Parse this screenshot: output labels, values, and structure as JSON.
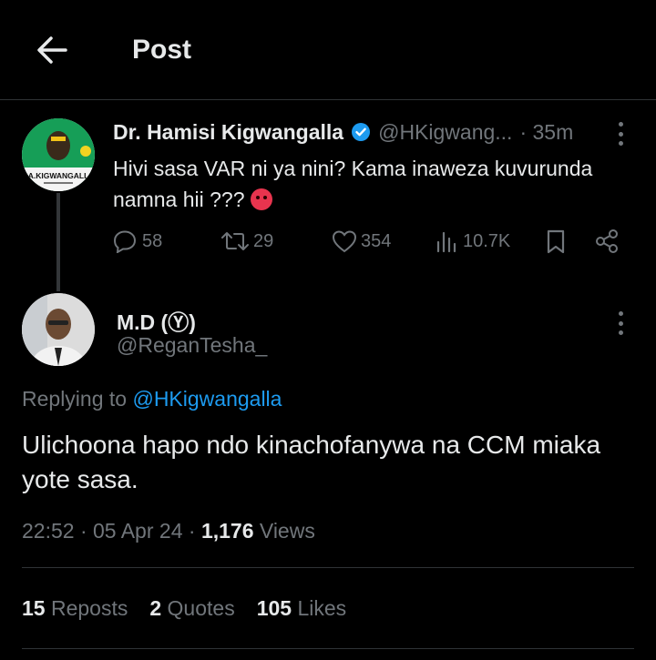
{
  "header": {
    "title": "Post"
  },
  "original_post": {
    "avatar_text": "A.KIGWANGALL",
    "author_name": "Dr. Hamisi Kigwangalla",
    "handle": "@HKigwang...",
    "time": "· 35m",
    "text": "Hivi sasa VAR ni ya nini? Kama inaweza kuvurunda namna hii ???",
    "emoji": "angry-face-emoji",
    "actions": {
      "replies": "58",
      "reposts": "29",
      "likes": "354",
      "views": "10.7K"
    }
  },
  "reply_post": {
    "author_name": "M.D (Ⓨ)",
    "handle": "@ReganTesha_",
    "replying_prefix": "Replying to",
    "replying_to": "@HKigwangalla",
    "text": "Ulichoona hapo ndo kinachofanywa na CCM miaka yote sasa.",
    "time": "22:52",
    "date": "05 Apr 24",
    "views_count": "1,176",
    "views_label": "Views"
  },
  "stats": {
    "reposts_count": "15",
    "reposts_label": "Reposts",
    "quotes_count": "2",
    "quotes_label": "Quotes",
    "likes_count": "105",
    "likes_label": "Likes"
  },
  "colors": {
    "background": "#000000",
    "text": "#e7e9ea",
    "muted": "#71767b",
    "accent": "#1d9bf0",
    "divider": "#2f3336"
  }
}
